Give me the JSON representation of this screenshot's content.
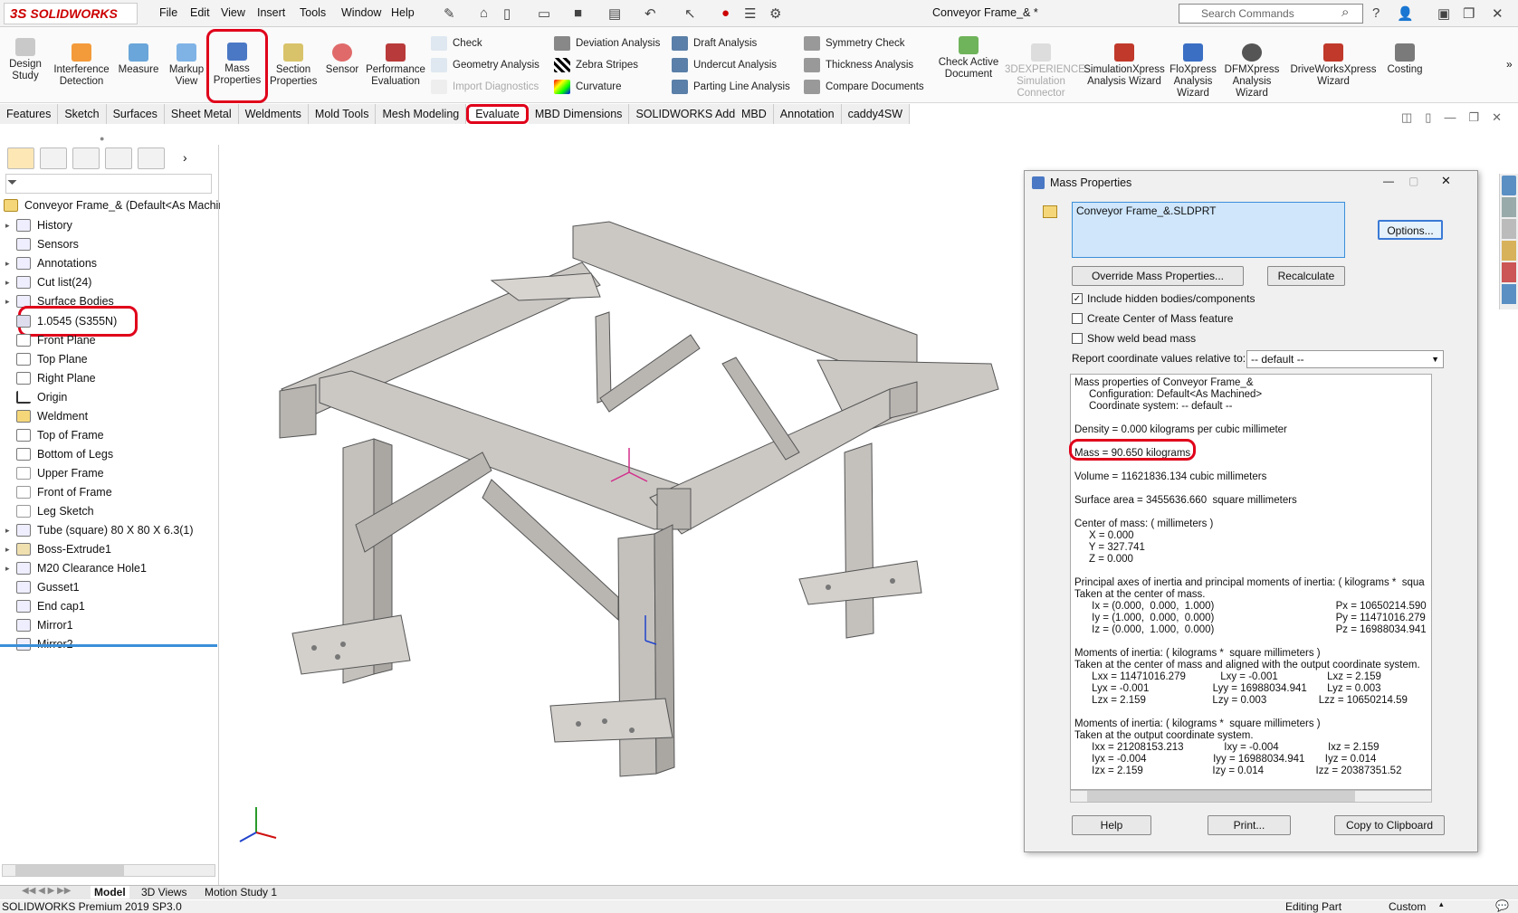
{
  "app": {
    "brand": "SOLIDWORKS",
    "doc_title": "Conveyor Frame_& *",
    "accent": "#e0001a"
  },
  "menu": [
    "File",
    "Edit",
    "View",
    "Insert",
    "Tools",
    "Window",
    "Help"
  ],
  "search": {
    "placeholder": "Search Commands"
  },
  "ribbon": {
    "design_study": "Design Study",
    "interference": "Interference Detection",
    "measure": "Measure",
    "markup": "Markup View",
    "mass": "Mass Properties",
    "section": "Section Properties",
    "sensor": "Sensor",
    "performance": "Performance Evaluation",
    "check": "Check",
    "geometry": "Geometry Analysis",
    "import_diag": "Import Diagnostics",
    "deviation": "Deviation Analysis",
    "zebra": "Zebra Stripes",
    "curvature": "Curvature",
    "draft": "Draft Analysis",
    "undercut": "Undercut Analysis",
    "parting": "Parting Line Analysis",
    "symmetry": "Symmetry Check",
    "thickness": "Thickness Analysis",
    "compare": "Compare Documents",
    "check_active": "Check Active Document",
    "x3d_sim": "3DEXPERIENCE Simulation Connector",
    "simxpress": "SimulationXpress Analysis Wizard",
    "floxpress": "FloXpress Analysis Wizard",
    "dfmxpress": "DFMXpress Analysis Wizard",
    "driveworks": "DriveWorksXpress Wizard",
    "costing": "Costing"
  },
  "tabs": [
    "Features",
    "Sketch",
    "Surfaces",
    "Sheet Metal",
    "Weldments",
    "Mold Tools",
    "Mesh Modeling",
    "Evaluate",
    "MBD Dimensions",
    "SOLIDWORKS Add-Ins",
    "MBD",
    "Annotation",
    "caddy4SW"
  ],
  "tree": {
    "root": "Conveyor Frame_&  (Default<As Machin",
    "items": [
      "History",
      "Sensors",
      "Annotations",
      "Cut list(24)",
      "Surface Bodies",
      "1.0545 (S355N)",
      "Front Plane",
      "Top Plane",
      "Right Plane",
      "Origin",
      "Weldment",
      "Top of Frame",
      "Bottom of Legs",
      "Upper Frame",
      "Front of Frame",
      "Leg Sketch",
      "Tube (square) 80 X 80 X 6.3(1)",
      "Boss-Extrude1",
      "M20 Clearance Hole1",
      "Gusset1",
      "End cap1",
      "Mirror1",
      "Mirror2"
    ]
  },
  "dialog": {
    "title": "Mass Properties",
    "selection": "Conveyor Frame_&.SLDPRT",
    "options_btn": "Options...",
    "override_btn": "Override Mass Properties...",
    "recalc_btn": "Recalculate",
    "chk_hidden": "Include hidden bodies/components",
    "chk_com": "Create Center of Mass feature",
    "chk_weld": "Show weld bead mass",
    "report_label": "Report coordinate values relative to:",
    "report_value": "-- default --",
    "results": "Mass properties of Conveyor Frame_&\n     Configuration: Default<As Machined>\n     Coordinate system: -- default --\n\nDensity = 0.000 kilograms per cubic millimeter\n\nMass = 90.650 kilograms\n\nVolume = 11621836.134 cubic millimeters\n\nSurface area = 3455636.660  square millimeters\n\nCenter of mass: ( millimeters )\n     X = 0.000\n     Y = 327.741\n     Z = 0.000\n\nPrincipal axes of inertia and principal moments of inertia: ( kilograms *  squa\nTaken at the center of mass.\n      Ix = (0.000,  0.000,  1.000)                                          Px = 10650214.590\n      Iy = (1.000,  0.000,  0.000)                                          Py = 11471016.279\n      Iz = (0.000,  1.000,  0.000)                                          Pz = 16988034.941\n\nMoments of inertia: ( kilograms *  square millimeters )\nTaken at the center of mass and aligned with the output coordinate system.\n      Lxx = 11471016.279            Lxy = -0.001                 Lxz = 2.159\n      Lyx = -0.001                      Lyy = 16988034.941       Lyz = 0.003\n      Lzx = 2.159                       Lzy = 0.003                  Lzz = 10650214.59\n\nMoments of inertia: ( kilograms *  square millimeters )\nTaken at the output coordinate system.\n      Ixx = 21208153.213              Ixy = -0.004                 Ixz = 2.159\n      Iyx = -0.004                       Iyy = 16988034.941       Iyz = 0.014\n      Izx = 2.159                        Izy = 0.014                  Izz = 20387351.52",
    "help_btn": "Help",
    "print_btn": "Print...",
    "copy_btn": "Copy to Clipboard"
  },
  "bottom_tabs": [
    "Model",
    "3D Views",
    "Motion Study 1"
  ],
  "status": {
    "left": "SOLIDWORKS Premium 2019 SP3.0",
    "mode": "Editing Part",
    "units": "Custom"
  }
}
